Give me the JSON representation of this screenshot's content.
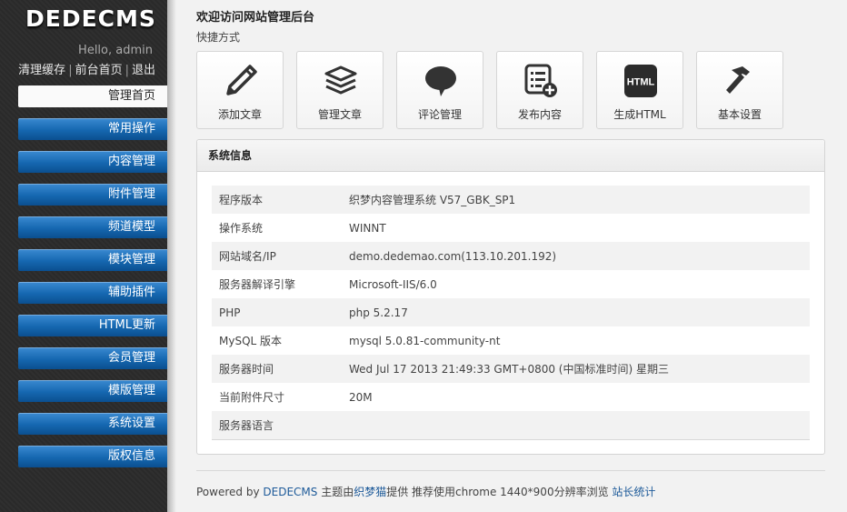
{
  "sidebar": {
    "logo": "DEDECMS",
    "hello": "Hello, admin",
    "links": [
      "清理缓存",
      "前台首页",
      "退出"
    ],
    "separator": "|",
    "menu": [
      "管理首页",
      "常用操作",
      "内容管理",
      "附件管理",
      "频道模型",
      "模块管理",
      "辅助插件",
      "HTML更新",
      "会员管理",
      "模版管理",
      "系统设置",
      "版权信息"
    ]
  },
  "main": {
    "welcome": "欢迎访问网站管理后台",
    "shortcut_label": "快捷方式",
    "shortcuts": [
      {
        "label": "添加文章",
        "icon": "pencil-icon"
      },
      {
        "label": "管理文章",
        "icon": "stack-icon"
      },
      {
        "label": "评论管理",
        "icon": "comment-icon"
      },
      {
        "label": "发布内容",
        "icon": "list-add-icon"
      },
      {
        "label": "生成HTML",
        "icon": "html-icon",
        "badge": "HTML"
      },
      {
        "label": "基本设置",
        "icon": "hammer-icon"
      }
    ],
    "panel": {
      "title": "系统信息",
      "rows": [
        {
          "k": "程序版本",
          "v": "织梦内容管理系统 V57_GBK_SP1"
        },
        {
          "k": "操作系统",
          "v": "WINNT"
        },
        {
          "k": "网站域名/IP",
          "v": "demo.dedemao.com(113.10.201.192)"
        },
        {
          "k": "服务器解译引擎",
          "v": "Microsoft-IIS/6.0"
        },
        {
          "k": "PHP",
          "v": "php 5.2.17"
        },
        {
          "k": "MySQL 版本",
          "v": "mysql 5.0.81-community-nt"
        },
        {
          "k": "服务器时间",
          "v": "Wed Jul 17 2013 21:49:33 GMT+0800 (中国标准时间) 星期三"
        },
        {
          "k": "当前附件尺寸",
          "v": "20M"
        },
        {
          "k": "服务器语言",
          "v": ""
        }
      ]
    }
  },
  "footer": {
    "prefix": "Powered by ",
    "brand": "DEDECMS",
    "theme_prefix": " 主题由",
    "theme_author": "织梦猫",
    "theme_suffix": "提供 推荐使用chrome 1440*900分辨率浏览 ",
    "stats": "站长统计"
  },
  "colors": {
    "sidebar_bg": "#2a2a2a",
    "menu_blue": "#1567b0",
    "link": "#1d5a99"
  }
}
